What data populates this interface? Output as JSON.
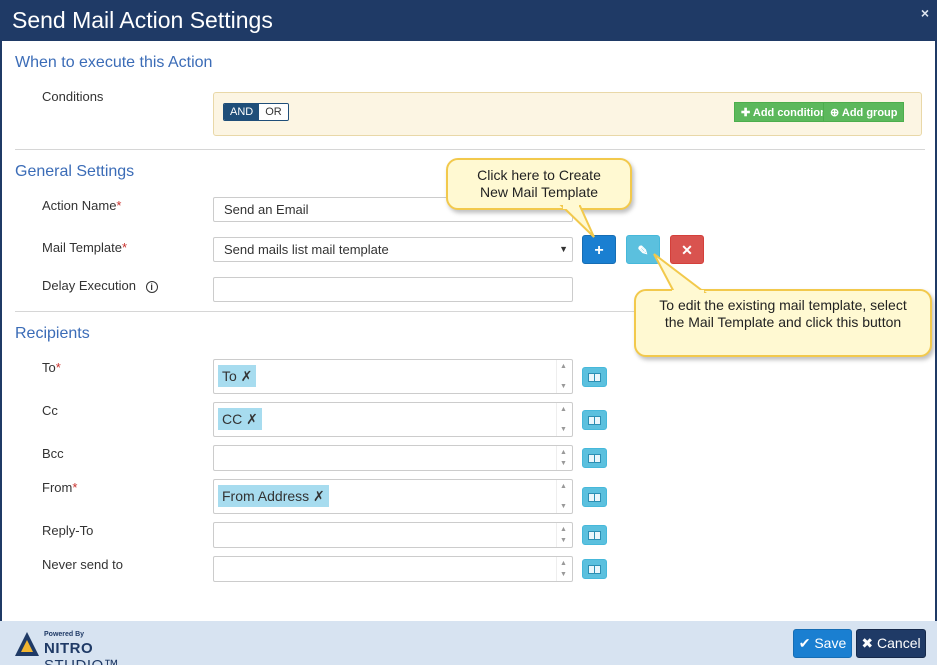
{
  "dialog": {
    "title": "Send Mail Action Settings",
    "close_glyph": "×"
  },
  "when": {
    "section_title": "When to execute this Action",
    "conditions_label": "Conditions",
    "and_label": "AND",
    "or_label": "OR",
    "add_condition_label": "Add condition",
    "add_group_label": "Add group"
  },
  "general": {
    "section_title": "General Settings",
    "action_name_label": "Action Name",
    "action_name_value": "Send an Email",
    "mail_template_label": "Mail Template",
    "mail_template_value": "Send mails list mail template",
    "delay_label": "Delay Execution",
    "delay_value": "",
    "required_mark": "*"
  },
  "recipients": {
    "section_title": "Recipients",
    "to_label": "To",
    "to_tag": "To ✗",
    "cc_label": "Cc",
    "cc_tag": "CC ✗",
    "bcc_label": "Bcc",
    "from_label": "From",
    "from_tag": "From Address ✗",
    "replyto_label": "Reply-To",
    "neversend_label": "Never send to"
  },
  "callouts": {
    "create_tip": "Click here to Create New Mail Template",
    "edit_tip": "To edit the existing mail template, select the Mail Template and click this button"
  },
  "footer": {
    "powered_by": "Powered By",
    "brand_bold": "NITRO",
    "brand_rest": " STUDIO™",
    "save_label": "Save",
    "cancel_label": "Cancel"
  },
  "colors": {
    "titlebar": "#1f3a66",
    "section_title": "#3b6cb7",
    "primary": "#1a7fd1",
    "info": "#5bc0de",
    "danger": "#d9534f",
    "success": "#5cb85c",
    "footer_bg": "#d7e3f1"
  }
}
